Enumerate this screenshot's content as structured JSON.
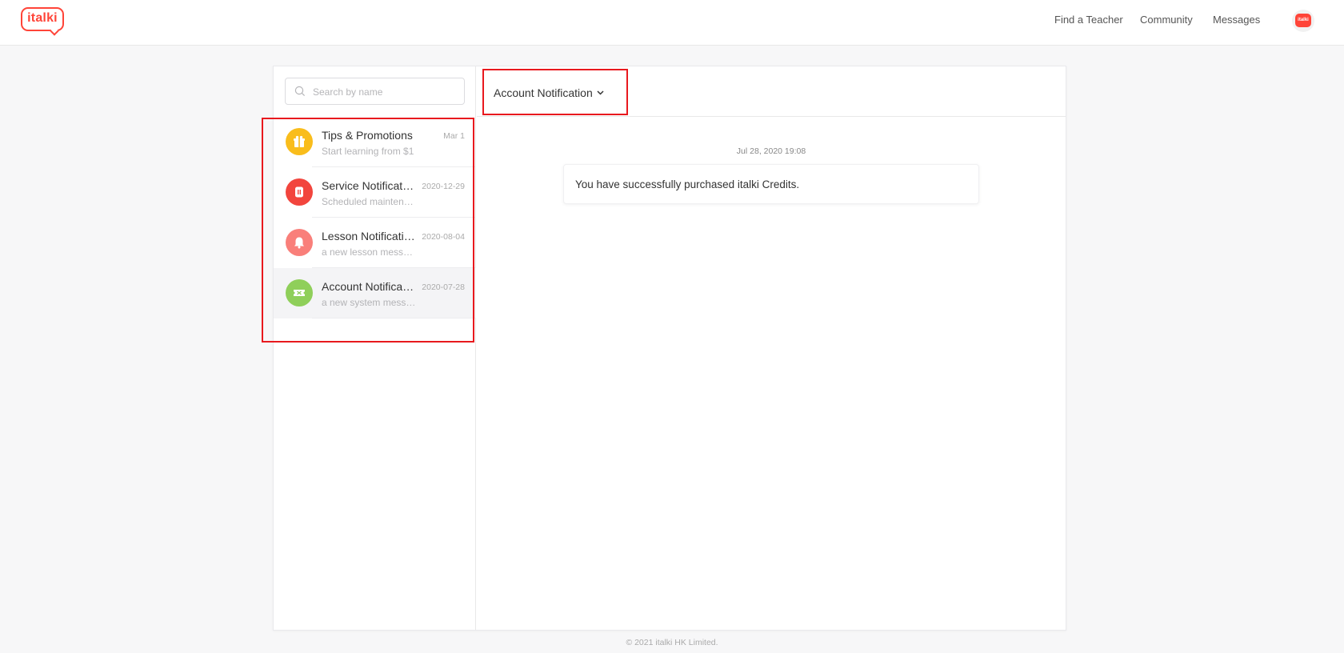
{
  "app": {
    "logo_text": "italki",
    "nav": [
      "Find a Teacher",
      "Community",
      "Messages"
    ],
    "avatar_text": "italki"
  },
  "search": {
    "placeholder": "Search by name"
  },
  "conversations": [
    {
      "title": "Tips & Promotions",
      "date": "Mar 1",
      "preview": "Start learning from $1",
      "icon": "gift-icon",
      "color": "#f9bd1c"
    },
    {
      "title": "Service Notification",
      "date": "2020-12-29",
      "preview": "Scheduled maintenance",
      "icon": "service-icon",
      "color": "#f2453d"
    },
    {
      "title": "Lesson Notification",
      "date": "2020-08-04",
      "preview": "a new lesson message",
      "icon": "bell-icon",
      "color": "#f97f7a"
    },
    {
      "title": "Account Notification",
      "date": "2020-07-28",
      "preview": "a new system message",
      "icon": "ticket-icon",
      "color": "#8fcf5a",
      "active": true
    }
  ],
  "thread": {
    "title": "Account Notification",
    "messages": [
      {
        "time": "Jul 28, 2020 19:08",
        "text": "You have successfully purchased italki Credits."
      }
    ]
  },
  "footer": "© 2021 italki HK Limited."
}
